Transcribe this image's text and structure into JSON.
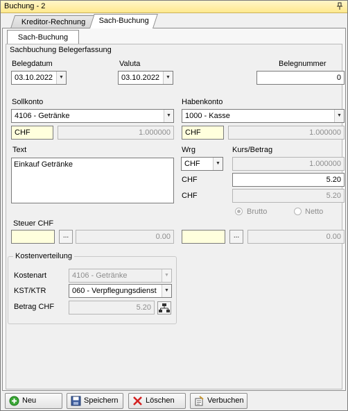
{
  "window": {
    "title": "Buchung - 2",
    "pin_icon": "pin-icon"
  },
  "tabs": [
    {
      "label": "Kreditor-Rechnung",
      "active": false
    },
    {
      "label": "Sach-Buchung",
      "active": true
    }
  ],
  "subtab": {
    "label": "Sach-Buchung"
  },
  "group": {
    "title": "Sachbuchung Belegerfassung",
    "belegdatum": {
      "label": "Belegdatum",
      "value": "03.10.2022"
    },
    "valuta": {
      "label": "Valuta",
      "value": "03.10.2022"
    },
    "belegnummer": {
      "label": "Belegnummer",
      "value": "0"
    },
    "sollkonto": {
      "label": "Sollkonto",
      "value": "4106 - Getränke",
      "currency": "CHF",
      "rate": "1.000000"
    },
    "habenkonto": {
      "label": "Habenkonto",
      "value": "1000 - Kasse",
      "currency": "CHF",
      "rate": "1.000000"
    },
    "text": {
      "label": "Text",
      "value": "Einkauf Getränke"
    },
    "wrg": {
      "label": "Wrg",
      "value": "CHF"
    },
    "kurs": {
      "label": "Kurs/Betrag",
      "value": "1.000000"
    },
    "betrag1": {
      "label": "CHF",
      "value": "5.20"
    },
    "betrag2": {
      "label": "CHF",
      "value": "5.20"
    },
    "radio": {
      "brutto": "Brutto",
      "netto": "Netto",
      "selected": "Brutto"
    },
    "steuer": {
      "label": "Steuer CHF",
      "left_value": "0.00",
      "right_value": "0.00",
      "button": "..."
    },
    "kostenverteilung": {
      "title": "Kostenverteilung",
      "kostenart": {
        "label": "Kostenart",
        "value": "4106 - Getränke"
      },
      "kst": {
        "label": "KST/KTR",
        "value": "060 - Verpflegungsdienst"
      },
      "betrag": {
        "label": "Betrag CHF",
        "value": "5.20"
      }
    }
  },
  "footer": {
    "neu": "Neu",
    "speichern": "Speichern",
    "loeschen": "Löschen",
    "verbuchen": "Verbuchen"
  },
  "colors": {
    "accent_title": "#ffe98e",
    "required_field": "#ffffdd",
    "add_green": "#3aa635",
    "delete_red": "#d42020"
  }
}
